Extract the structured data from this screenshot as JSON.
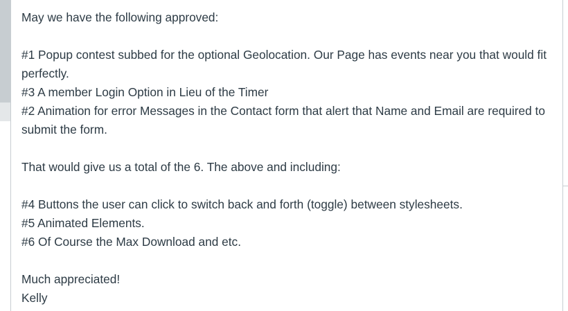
{
  "message": {
    "greeting": "May we have the following approved:",
    "items_a": [
      "#1 Popup contest subbed for the optional Geolocation. Our Page has events near you that would fit perfectly.",
      "#3 A member Login Option in Lieu of the Timer",
      "#2 Animation for error Messages in the Contact form that alert that Name and Email are required to submit the form."
    ],
    "summary": "That would give us a total of the 6. The above and including:",
    "items_b": [
      "#4 Buttons the user can click to switch back and forth (toggle) between stylesheets.",
      "#5 Animated Elements.",
      "#6 Of Course the Max Download and etc."
    ],
    "closing": "Much appreciated!",
    "signature": "Kelly"
  }
}
